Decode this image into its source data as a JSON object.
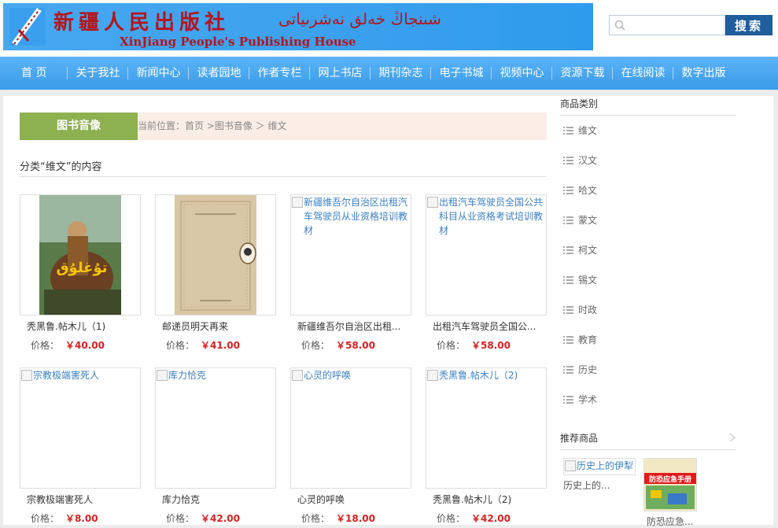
{
  "header": {
    "logo_cn": "新疆人民出版社",
    "logo_ug": "شىنجاڭ خەلق نەشرىياتى",
    "logo_en": "XinJiang People's Publishing House",
    "search_placeholder": "",
    "search_label": "搜索"
  },
  "nav": [
    "首 页",
    "关于我社",
    "新闻中心",
    "读者园地",
    "作者专栏",
    "网上书店",
    "期刊杂志",
    "电子书城",
    "视频中心",
    "资源下载",
    "在线阅读",
    "数字出版"
  ],
  "crumb": {
    "tab": "图书音像",
    "text": "当前位置：首页 >图书音像 ＞ 维文"
  },
  "section_title": "分类“维文”的内容",
  "products": [
    {
      "name": "秃黑鲁.帖木儿（1)",
      "price_label": "价格：",
      "price": "￥40.00",
      "image": "cover-1",
      "alt": ""
    },
    {
      "name": "邮递员明天再来",
      "price_label": "价格：",
      "price": "￥41.00",
      "image": "cover-2",
      "alt": ""
    },
    {
      "name": "新疆维吾尔自治区出租...",
      "price_label": "价格：",
      "price": "￥58.00",
      "image": "",
      "alt": "新疆维吾尔自治区出租汽车驾驶员从业资格培训教材"
    },
    {
      "name": "出租汽车驾驶员全国公...",
      "price_label": "价格：",
      "price": "￥58.00",
      "image": "",
      "alt": "出租汽车驾驶员全国公共科目从业资格考试培训教材"
    },
    {
      "name": "宗教极端害死人",
      "price_label": "价格：",
      "price": "￥8.00",
      "image": "",
      "alt": "宗教极端害死人"
    },
    {
      "name": "库力恰克",
      "price_label": "价格：",
      "price": "￥42.00",
      "image": "",
      "alt": "库力恰克"
    },
    {
      "name": "心灵的呼唤",
      "price_label": "价格：",
      "price": "￥18.00",
      "image": "",
      "alt": "心灵的呼唤"
    },
    {
      "name": "秃黑鲁.帖木儿（2)",
      "price_label": "价格：",
      "price": "￥42.00",
      "image": "",
      "alt": "秃黑鲁.帖木儿（2)"
    }
  ],
  "sidebar": {
    "categories_title": "商品类别",
    "categories": [
      "维文",
      "汉文",
      "哈文",
      "蒙文",
      "柯文",
      "锡文",
      "时政",
      "教育",
      "历史",
      "学术"
    ],
    "recommend_title": "推荐商品",
    "recommend": [
      {
        "name": "历史上的...",
        "alt": "历史上的伊犁"
      },
      {
        "name": "防恐应急...",
        "alt": "",
        "cover_text": "防恐应急手册"
      }
    ]
  },
  "colors": {
    "nav_bg": "#3b9be8",
    "crumb_tab": "#8db051",
    "price": "#d8201f",
    "search_btn": "#1f5d9c",
    "logo_text": "#b5151b"
  }
}
